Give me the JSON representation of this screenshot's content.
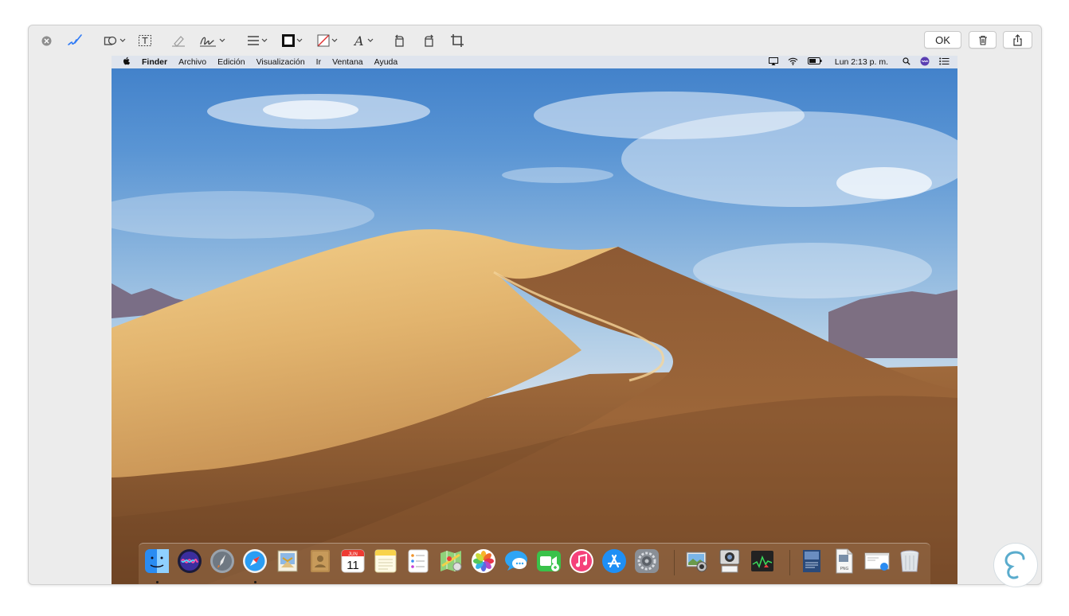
{
  "toolbar": {
    "ok_label": "OK",
    "tools": [
      {
        "name": "close-icon"
      },
      {
        "name": "sketch-pen-icon"
      },
      {
        "name": "shapes-icon"
      },
      {
        "name": "text-box-icon"
      },
      {
        "name": "highlighter-icon"
      },
      {
        "name": "signature-icon"
      },
      {
        "name": "line-style-icon"
      },
      {
        "name": "border-color-icon"
      },
      {
        "name": "fill-color-icon"
      },
      {
        "name": "text-style-icon"
      },
      {
        "name": "rotate-left-icon"
      },
      {
        "name": "rotate-right-icon"
      },
      {
        "name": "crop-icon"
      },
      {
        "name": "trash-icon"
      },
      {
        "name": "share-icon"
      }
    ],
    "colors": {
      "accent": "#2f7bf6",
      "border": "#111111",
      "fill_slash": "#e03030"
    }
  },
  "menubar": {
    "items": [
      {
        "label": "Finder",
        "bold": true
      },
      {
        "label": "Archivo"
      },
      {
        "label": "Edición"
      },
      {
        "label": "Visualización"
      },
      {
        "label": "Ir"
      },
      {
        "label": "Ventana"
      },
      {
        "label": "Ayuda"
      }
    ],
    "clock": "Lun 2:13 p. m.",
    "status_icons": [
      "airplay-icon",
      "wifi-icon",
      "battery-icon",
      "spotlight-search-icon",
      "siri-icon",
      "notification-center-icon"
    ]
  },
  "dock": {
    "calendar": {
      "month": "JUN",
      "day": "11"
    },
    "preview_label": "PNG",
    "apps": [
      "finder-icon",
      "siri-icon",
      "launchpad-icon",
      "safari-icon",
      "mail-icon",
      "contacts-icon",
      "calendar-icon",
      "notes-icon",
      "reminders-icon",
      "maps-icon",
      "photos-icon",
      "messages-icon",
      "facetime-icon",
      "itunes-icon",
      "app-store-icon",
      "system-preferences-icon",
      "image-capture-icon",
      "screenshot-icon",
      "activity-monitor-icon",
      "downloads-folder-icon",
      "preview-file-icon",
      "screen-window-icon",
      "trash-icon"
    ]
  }
}
